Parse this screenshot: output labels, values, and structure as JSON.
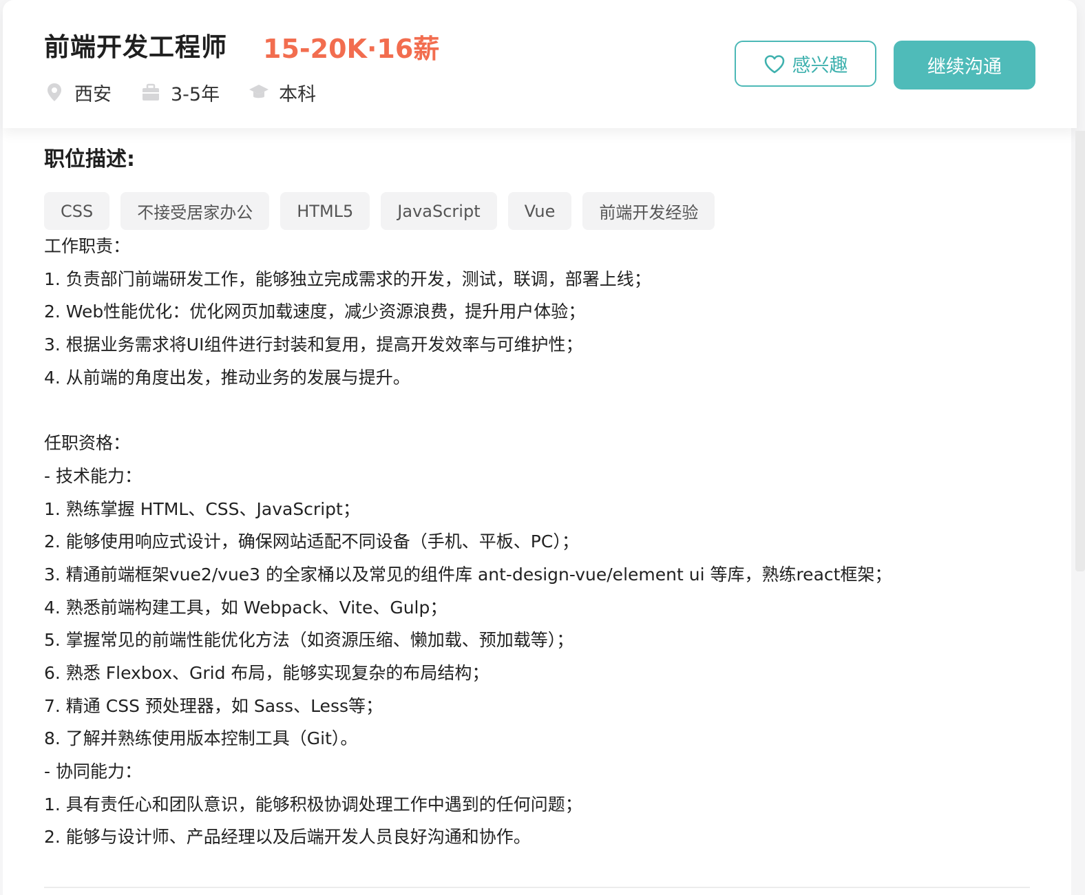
{
  "job": {
    "title": "前端开发工程师",
    "salary": "15-20K·16薪",
    "location": "西安",
    "experience": "3-5年",
    "education": "本科"
  },
  "actions": {
    "interest_label": "感兴趣",
    "chat_label": "继续沟通"
  },
  "icons": {
    "location": "location-pin-icon",
    "experience": "briefcase-icon",
    "education": "graduation-cap-icon",
    "interest": "heart-icon"
  },
  "colors": {
    "accent": "#4fbbb9",
    "salary": "#f26d4f",
    "tag_bg": "#f3f3f4"
  },
  "description": {
    "title": "职位描述:",
    "tags": [
      "CSS",
      "不接受居家办公",
      "HTML5",
      "JavaScript",
      "Vue",
      "前端开发经验"
    ],
    "lines": [
      "工作职责：",
      "1. 负责部门前端研发工作，能够独立完成需求的开发，测试，联调，部署上线；",
      "2. Web性能优化：优化网页加载速度，减少资源浪费，提升用户体验；",
      "3. 根据业务需求将UI组件进行封装和复用，提高开发效率与可维护性；",
      "4. 从前端的角度出发，推动业务的发展与提升。",
      "",
      "任职资格：",
      "- 技术能力：",
      "1. 熟练掌握 HTML、CSS、JavaScript；",
      "2. 能够使用响应式设计，确保网站适配不同设备（手机、平板、PC）；",
      "3. 精通前端框架vue2/vue3 的全家桶以及常见的组件库 ant-design-vue/element ui 等库，熟练react框架；",
      "4. 熟悉前端构建工具，如 Webpack、Vite、Gulp；",
      "5. 掌握常见的前端性能优化方法（如资源压缩、懒加载、预加载等）；",
      "6. 熟悉 Flexbox、Grid 布局，能够实现复杂的布局结构；",
      "7. 精通 CSS 预处理器，如 Sass、Less等；",
      "8. 了解并熟练使用版本控制工具（Git）。",
      "- 协同能力：",
      "1. 具有责任心和团队意识，能够积极协调处理工作中遇到的任何问题；",
      "2. 能够与设计师、产品经理以及后端开发人员良好沟通和协作。"
    ]
  }
}
